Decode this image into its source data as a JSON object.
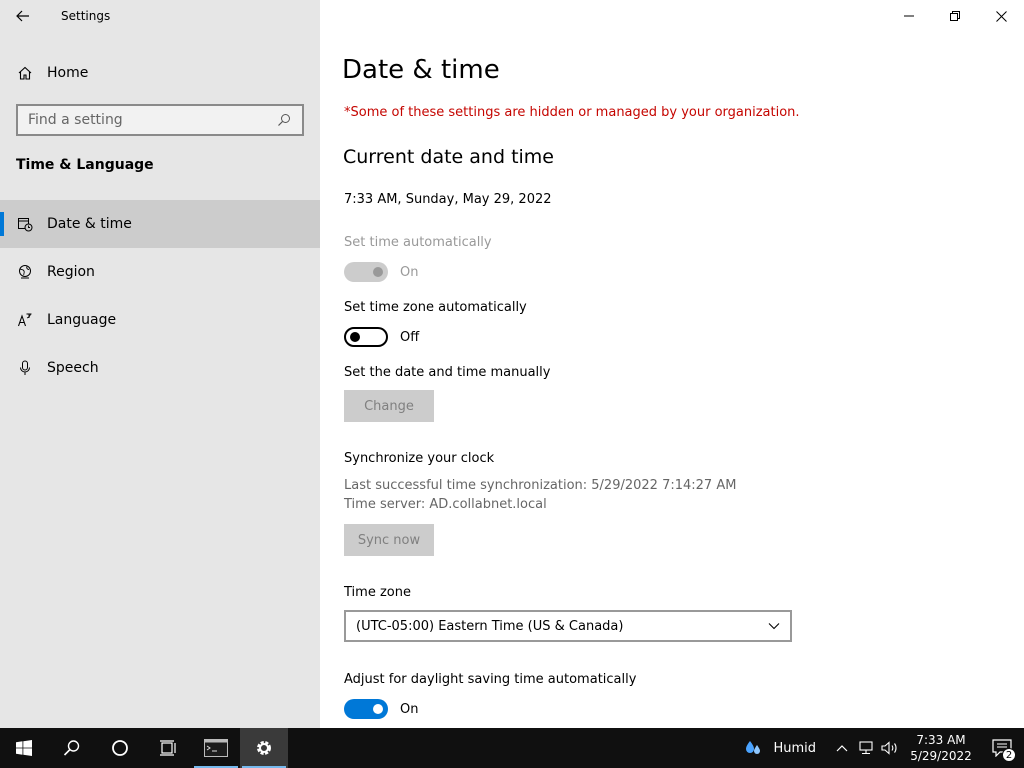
{
  "window": {
    "app_title": "Settings"
  },
  "sidebar": {
    "home_label": "Home",
    "search_placeholder": "Find a setting",
    "section_title": "Time & Language",
    "items": [
      {
        "label": "Date & time",
        "icon": "calendar-clock-icon",
        "active": true
      },
      {
        "label": "Region",
        "icon": "globe-icon",
        "active": false
      },
      {
        "label": "Language",
        "icon": "language-icon",
        "active": false
      },
      {
        "label": "Speech",
        "icon": "microphone-icon",
        "active": false
      }
    ]
  },
  "main": {
    "title": "Date & time",
    "org_note": "*Some of these settings are hidden or managed by your organization.",
    "current_heading": "Current date and time",
    "current_value": "7:33 AM, Sunday, May 29, 2022",
    "set_time_auto": {
      "label": "Set time automatically",
      "state": "On",
      "enabled": false
    },
    "set_tz_auto": {
      "label": "Set time zone automatically",
      "state": "Off"
    },
    "manual": {
      "label": "Set the date and time manually",
      "button": "Change"
    },
    "sync": {
      "heading": "Synchronize your clock",
      "last_sync": "Last successful time synchronization: 5/29/2022 7:14:27 AM",
      "server": "Time server: AD.collabnet.local",
      "button": "Sync now"
    },
    "timezone": {
      "label": "Time zone",
      "value": "(UTC-05:00) Eastern Time (US & Canada)"
    },
    "dst": {
      "label": "Adjust for daylight saving time automatically",
      "state": "On"
    }
  },
  "taskbar": {
    "weather": "Humid",
    "time": "7:33 AM",
    "date": "5/29/2022",
    "notification_count": "2"
  },
  "colors": {
    "accent": "#0078d7",
    "warning": "#c50500",
    "sidebar_bg": "#e6e6e6",
    "taskbar_bg": "#101010"
  }
}
